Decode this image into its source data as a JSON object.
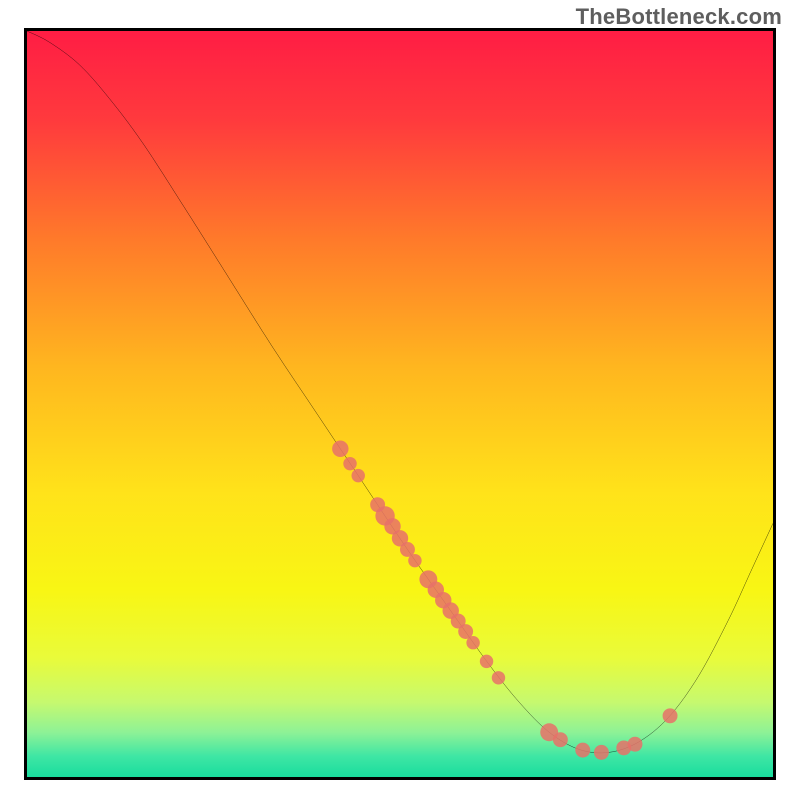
{
  "watermark": "TheBottleneck.com",
  "colors": {
    "curve": "#000000",
    "point_fill": "#e77168",
    "point_alpha": 0.85,
    "frame": "#000000"
  },
  "gradient_stops": [
    {
      "offset": 0.0,
      "color": "#ff1d44"
    },
    {
      "offset": 0.12,
      "color": "#ff3a3d"
    },
    {
      "offset": 0.28,
      "color": "#ff7a2a"
    },
    {
      "offset": 0.45,
      "color": "#ffb61f"
    },
    {
      "offset": 0.62,
      "color": "#ffe31a"
    },
    {
      "offset": 0.75,
      "color": "#f8f614"
    },
    {
      "offset": 0.84,
      "color": "#e9fb3a"
    },
    {
      "offset": 0.9,
      "color": "#c6f96f"
    },
    {
      "offset": 0.94,
      "color": "#8ef296"
    },
    {
      "offset": 0.972,
      "color": "#3fe6a4"
    },
    {
      "offset": 1.0,
      "color": "#19dd9e"
    }
  ],
  "chart_data": {
    "type": "line",
    "title": "",
    "xlabel": "",
    "ylabel": "",
    "xlim": [
      0,
      100
    ],
    "ylim": [
      0,
      100
    ],
    "note": "x,y are percentage coordinates inside the plot frame; y measured from top (0) to bottom (100). The curve starts top-left, trends steeply down, flattens near the bottom around x≈70–82, then rises toward the right edge.",
    "curve": [
      {
        "x": 0.0,
        "y": 0.0
      },
      {
        "x": 3.0,
        "y": 1.5
      },
      {
        "x": 7.0,
        "y": 4.5
      },
      {
        "x": 11.0,
        "y": 9.0
      },
      {
        "x": 15.5,
        "y": 15.0
      },
      {
        "x": 21.0,
        "y": 23.5
      },
      {
        "x": 27.0,
        "y": 33.0
      },
      {
        "x": 33.0,
        "y": 42.5
      },
      {
        "x": 39.0,
        "y": 51.5
      },
      {
        "x": 45.0,
        "y": 60.5
      },
      {
        "x": 51.0,
        "y": 69.5
      },
      {
        "x": 57.0,
        "y": 78.0
      },
      {
        "x": 62.0,
        "y": 85.0
      },
      {
        "x": 66.0,
        "y": 90.0
      },
      {
        "x": 70.0,
        "y": 94.0
      },
      {
        "x": 74.0,
        "y": 96.3
      },
      {
        "x": 78.0,
        "y": 96.7
      },
      {
        "x": 82.0,
        "y": 95.3
      },
      {
        "x": 86.0,
        "y": 92.0
      },
      {
        "x": 90.0,
        "y": 86.5
      },
      {
        "x": 94.0,
        "y": 79.0
      },
      {
        "x": 97.0,
        "y": 72.5
      },
      {
        "x": 100.0,
        "y": 66.0
      }
    ],
    "points": [
      {
        "x": 42.0,
        "y": 56.0,
        "r": 1.1
      },
      {
        "x": 43.3,
        "y": 58.0,
        "r": 0.9
      },
      {
        "x": 44.4,
        "y": 59.6,
        "r": 0.9
      },
      {
        "x": 47.0,
        "y": 63.5,
        "r": 1.0
      },
      {
        "x": 48.0,
        "y": 65.0,
        "r": 1.3
      },
      {
        "x": 49.0,
        "y": 66.4,
        "r": 1.1
      },
      {
        "x": 50.0,
        "y": 68.0,
        "r": 1.1
      },
      {
        "x": 51.0,
        "y": 69.5,
        "r": 1.0
      },
      {
        "x": 52.0,
        "y": 71.0,
        "r": 0.9
      },
      {
        "x": 53.8,
        "y": 73.5,
        "r": 1.2
      },
      {
        "x": 54.8,
        "y": 74.9,
        "r": 1.1
      },
      {
        "x": 55.8,
        "y": 76.3,
        "r": 1.1
      },
      {
        "x": 56.8,
        "y": 77.7,
        "r": 1.1
      },
      {
        "x": 57.8,
        "y": 79.1,
        "r": 1.0
      },
      {
        "x": 58.8,
        "y": 80.5,
        "r": 1.0
      },
      {
        "x": 59.8,
        "y": 82.0,
        "r": 0.9
      },
      {
        "x": 61.6,
        "y": 84.5,
        "r": 0.9
      },
      {
        "x": 63.2,
        "y": 86.7,
        "r": 0.9
      },
      {
        "x": 70.0,
        "y": 94.0,
        "r": 1.2
      },
      {
        "x": 71.5,
        "y": 95.0,
        "r": 1.0
      },
      {
        "x": 74.5,
        "y": 96.4,
        "r": 1.0
      },
      {
        "x": 77.0,
        "y": 96.7,
        "r": 1.0
      },
      {
        "x": 80.0,
        "y": 96.1,
        "r": 1.0
      },
      {
        "x": 81.5,
        "y": 95.6,
        "r": 1.0
      },
      {
        "x": 86.2,
        "y": 91.8,
        "r": 1.0
      }
    ]
  }
}
